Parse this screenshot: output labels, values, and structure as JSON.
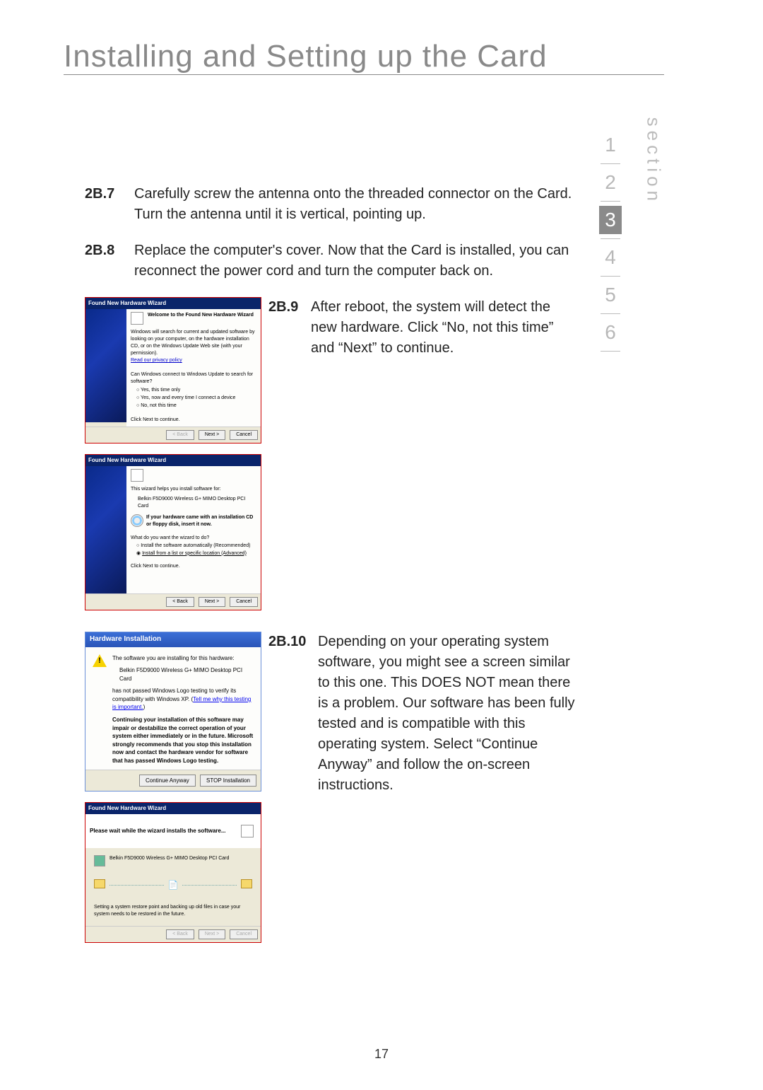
{
  "title": "Installing and Setting up the Card",
  "page_number": "17",
  "nav": {
    "label": "section",
    "items": [
      "1",
      "2",
      "3",
      "4",
      "5",
      "6"
    ],
    "active_index": 2
  },
  "steps": {
    "s2b7": {
      "num": "2B.7",
      "text": "Carefully screw the antenna onto the threaded connector on the Card. Turn the antenna until it is vertical, pointing up."
    },
    "s2b8": {
      "num": "2B.8",
      "text": "Replace the computer's cover. Now that the Card is installed, you can reconnect the power cord and turn the computer back on."
    },
    "s2b9": {
      "num": "2B.9",
      "text": "After reboot, the system will detect the new hardware. Click “No, not this time” and “Next” to continue."
    },
    "s2b10": {
      "num": "2B.10",
      "text": "Depending on your operating system software, you might see a screen similar to this one. This DOES NOT mean there is a problem. Our software has been fully tested and is compatible with this operating system. Select “Continue Anyway” and follow the on-screen instructions."
    }
  },
  "wiz1": {
    "title": "Found New Hardware Wizard",
    "heading": "Welcome to the Found New Hardware Wizard",
    "intro": "Windows will search for current and updated software by looking on your computer, on the hardware installation CD, or on the Windows Update Web site (with your permission).",
    "privacy": "Read our privacy policy",
    "question": "Can Windows connect to Windows Update to search for software?",
    "opt1": "Yes, this time only",
    "opt2": "Yes, now and every time I connect a device",
    "opt3": "No, not this time",
    "cont": "Click Next to continue.",
    "back": "< Back",
    "next": "Next >",
    "cancel": "Cancel"
  },
  "wiz2": {
    "title": "Found New Hardware Wizard",
    "intro": "This wizard helps you install software for:",
    "device": "Belkin F5D9000 Wireless G+ MIMO Desktop PCI Card",
    "cdnote": "If your hardware came with an installation CD or floppy disk, insert it now.",
    "question": "What do you want the wizard to do?",
    "opt1": "Install the software automatically (Recommended)",
    "opt2": "Install from a list or specific location (Advanced)",
    "cont": "Click Next to continue.",
    "back": "< Back",
    "next": "Next >",
    "cancel": "Cancel"
  },
  "hi": {
    "title": "Hardware Installation",
    "line1": "The software you are installing for this hardware:",
    "device": "Belkin F5D9000 Wireless G+ MIMO Desktop PCI Card",
    "line2a": "has not passed Windows Logo testing to verify its compatibility with Windows XP. (",
    "link": "Tell me why this testing is important.",
    "line2b": ")",
    "warn": "Continuing your installation of this software may impair or destabilize the correct operation of your system either immediately or in the future. Microsoft strongly recommends that you stop this installation now and contact the hardware vendor for software that has passed Windows Logo testing.",
    "cont": "Continue Anyway",
    "stop": "STOP Installation"
  },
  "prog": {
    "title": "Found New Hardware Wizard",
    "heading": "Please wait while the wizard installs the software...",
    "device": "Belkin F5D9000 Wireless G+ MIMO Desktop PCI Card",
    "note": "Setting a system restore point and backing up old files in case your system needs to be restored in the future.",
    "back": "< Back",
    "next": "Next >",
    "cancel": "Cancel"
  }
}
